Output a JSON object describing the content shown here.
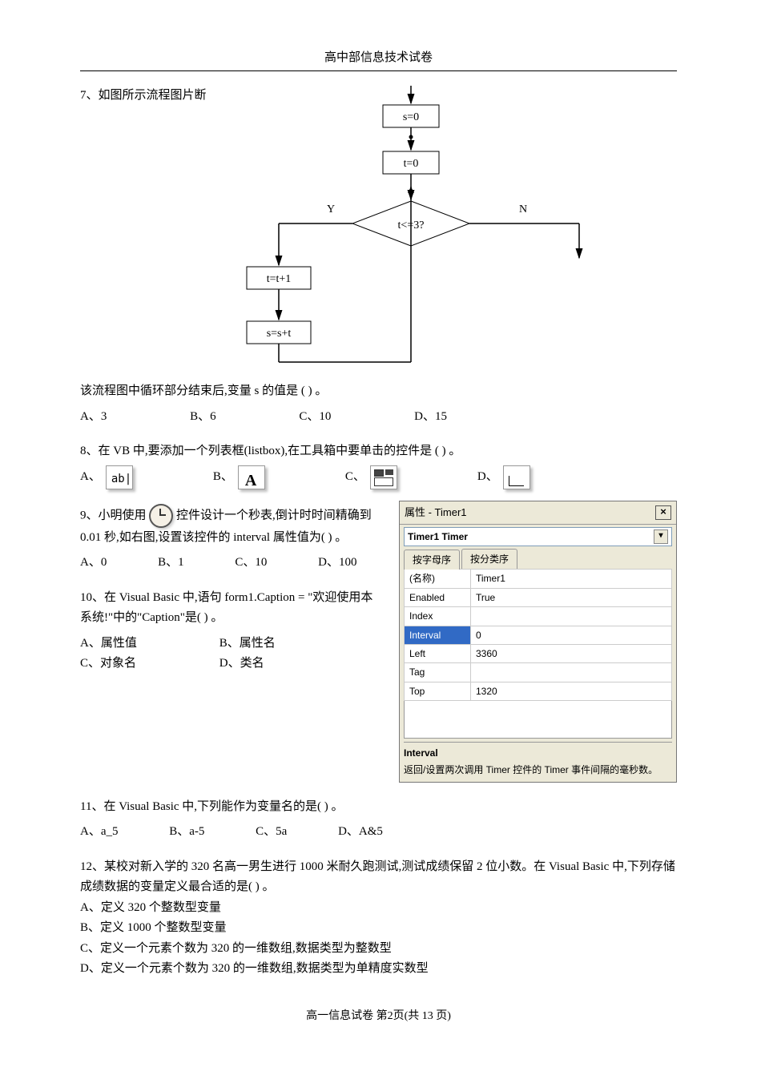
{
  "page_title": "高中部信息技术试卷",
  "q7": {
    "stem": "7、如图所示流程图片断",
    "flow": {
      "box1": "s=0",
      "box2": "t=0",
      "diamond": "t<=3?",
      "yes": "Y",
      "no": "N",
      "box3": "t=t+1",
      "box4": "s=s+t"
    },
    "tail": "该流程图中循环部分结束后,变量 s 的值是 (        ) 。",
    "opts": {
      "A": "A、3",
      "B": "B、6",
      "C": "C、10",
      "D": "D、15"
    }
  },
  "q8": {
    "stem": "8、在 VB 中,要添加一个列表框(listbox),在工具箱中要单击的控件是  (        ) 。",
    "opts": {
      "A": "A、",
      "B": "B、",
      "C": "C、",
      "D": "D、"
    }
  },
  "q9": {
    "pre": "9、小明使用",
    "post": "控件设计一个秒表,倒计时时间精确到 0.01 秒,如右图,设置该控件的 interval 属性值为(        ) 。",
    "opts": {
      "A": "A、0",
      "B": "B、1",
      "C": "C、10",
      "D": "D、100"
    },
    "prop": {
      "title": "属性 - Timer1",
      "dropdown": "Timer1 Timer",
      "tab1": "按字母序",
      "tab2": "按分类序",
      "rows": [
        {
          "k": "(名称)",
          "v": "Timer1"
        },
        {
          "k": "Enabled",
          "v": "True"
        },
        {
          "k": "Index",
          "v": ""
        },
        {
          "k": "Interval",
          "v": "0"
        },
        {
          "k": "Left",
          "v": "3360"
        },
        {
          "k": "Tag",
          "v": ""
        },
        {
          "k": "Top",
          "v": "1320"
        }
      ],
      "desc_title": "Interval",
      "desc_body": "返回/设置两次调用 Timer 控件的 Timer 事件间隔的毫秒数。"
    }
  },
  "q10": {
    "stem": "10、在 Visual Basic 中,语句 form1.Caption = \"欢迎使用本系统!\"中的\"Caption\"是(        ) 。",
    "opts": {
      "A": "A、属性值",
      "B": "B、属性名",
      "C": "C、对象名",
      "D": "D、类名"
    }
  },
  "q11": {
    "stem": "11、在 Visual Basic 中,下列能作为变量名的是(        ) 。",
    "opts": {
      "A": "A、a_5",
      "B": "B、a-5",
      "C": "C、5a",
      "D": "D、A&5"
    }
  },
  "q12": {
    "stem": "12、某校对新入学的 320 名高一男生进行 1000 米耐久跑测试,测试成绩保留 2 位小数。在 Visual Basic 中,下列存储成绩数据的变量定义最合适的是(        ) 。",
    "opts": {
      "A": "A、定义 320 个整数型变量",
      "B": "B、定义 1000 个整数型变量",
      "C": "C、定义一个元素个数为 320 的一维数组,数据类型为整数型",
      "D": "D、定义一个元素个数为 320 的一维数组,数据类型为单精度实数型"
    }
  },
  "footer": {
    "line": "高一信息试卷 第2页(共 13 页)"
  }
}
